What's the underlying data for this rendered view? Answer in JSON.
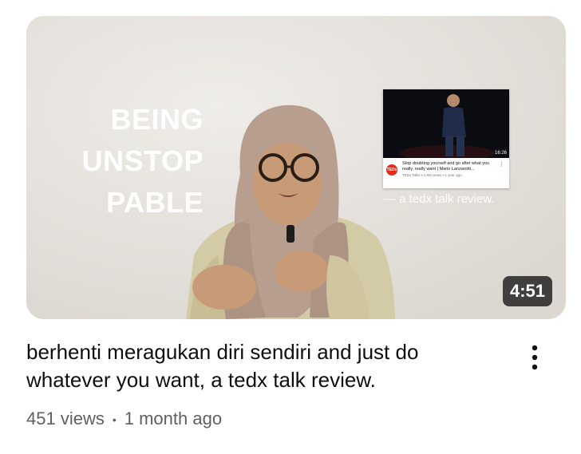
{
  "thumbnail": {
    "overlay_lines": [
      "BEING",
      "UNSTOP",
      "PABLE"
    ],
    "duration": "4:51",
    "review_caption": "— a tedx talk review.",
    "embedded_card": {
      "duration": "16:26",
      "logo": "TEDx",
      "title": "Stop doubting yourself and go after what you really, really want | Mario Lanzarotti...",
      "meta": "TEDx Talks • 1.6M views • 1 year ago"
    }
  },
  "video": {
    "title": "berhenti meragukan diri sendiri and just do whatever you want, a tedx talk review.",
    "views": "451 views",
    "separator": "•",
    "age": "1 month ago"
  },
  "icons": {
    "more": "more-vert-icon"
  },
  "colors": {
    "title_text": "#0f0f0f",
    "meta_text": "#606060",
    "badge_bg": "#141414",
    "tedx_red": "#e62b1e"
  }
}
